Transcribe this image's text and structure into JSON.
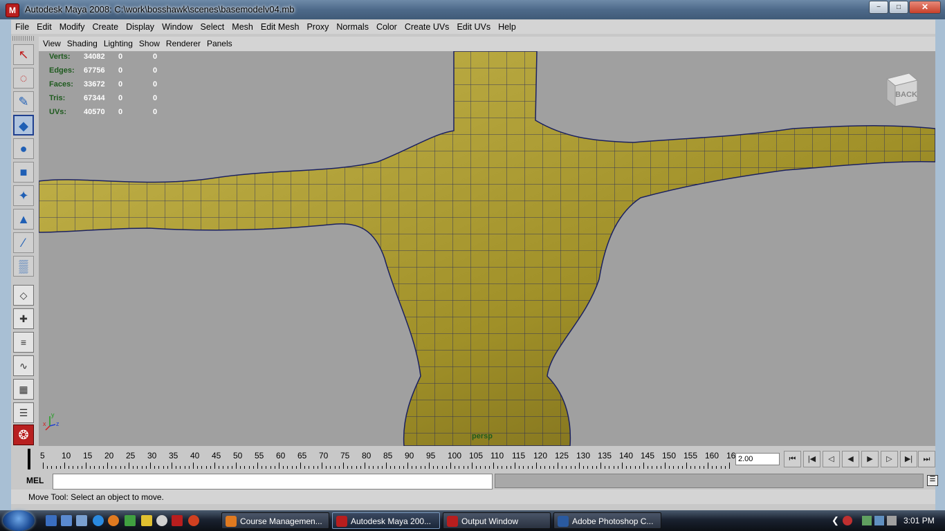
{
  "window": {
    "title": "Autodesk Maya 2008: C:\\work\\bosshawk\\scenes\\basemodelv04.mb",
    "minimize": "−",
    "maximize": "□",
    "close": "✕"
  },
  "menubar": [
    "File",
    "Edit",
    "Modify",
    "Create",
    "Display",
    "Window",
    "Select",
    "Mesh",
    "Edit Mesh",
    "Proxy",
    "Normals",
    "Color",
    "Create UVs",
    "Edit UVs",
    "Help"
  ],
  "panel_menu": [
    "View",
    "Shading",
    "Lighting",
    "Show",
    "Renderer",
    "Panels"
  ],
  "hud": [
    {
      "label": "Verts:",
      "v1": "34082",
      "v2": "0",
      "v3": "0"
    },
    {
      "label": "Edges:",
      "v1": "67756",
      "v2": "0",
      "v3": "0"
    },
    {
      "label": "Faces:",
      "v1": "33672",
      "v2": "0",
      "v3": "0"
    },
    {
      "label": "Tris:",
      "v1": "67344",
      "v2": "0",
      "v3": "0"
    },
    {
      "label": "UVs:",
      "v1": "40570",
      "v2": "0",
      "v3": "0"
    }
  ],
  "viewcube_label": "BACK",
  "camera_label": "persp",
  "axis": {
    "x": "x",
    "y": "y",
    "z": "z"
  },
  "tools": [
    "select-tool",
    "lasso-tool",
    "paint-select-tool",
    "move-tool",
    "rotate-tool",
    "scale-tool",
    "universal-manipulator",
    "soft-mod-tool",
    "show-manipulator",
    "last-tool"
  ],
  "timeline": {
    "labels": [
      "5",
      "10",
      "15",
      "20",
      "25",
      "30",
      "35",
      "40",
      "45",
      "50",
      "55",
      "60",
      "65",
      "70",
      "75",
      "80",
      "85",
      "90",
      "95",
      "100",
      "105",
      "110",
      "115",
      "120",
      "125",
      "130",
      "135",
      "140",
      "145",
      "150",
      "155",
      "160",
      "16"
    ],
    "current_frame_marker": "2",
    "current_time": "2.00"
  },
  "playback": [
    "⏮",
    "⏮",
    "|◀",
    "◀",
    "▶",
    "▶|",
    "⏭",
    "⏭"
  ],
  "mel": {
    "label": "MEL",
    "input": "",
    "script_button": "☰"
  },
  "help_line": "Move Tool: Select an object to move.",
  "taskbar": {
    "tasks": [
      {
        "label": "Course Managemen...",
        "color": "#e07a20",
        "active": false
      },
      {
        "label": "Autodesk Maya 200...",
        "color": "#b81e1e",
        "active": true
      },
      {
        "label": "Output Window",
        "color": "#b81e1e",
        "active": false
      },
      {
        "label": "Adobe Photoshop C...",
        "color": "#2a5aa0",
        "active": false
      }
    ],
    "clock": "3:01 PM"
  }
}
